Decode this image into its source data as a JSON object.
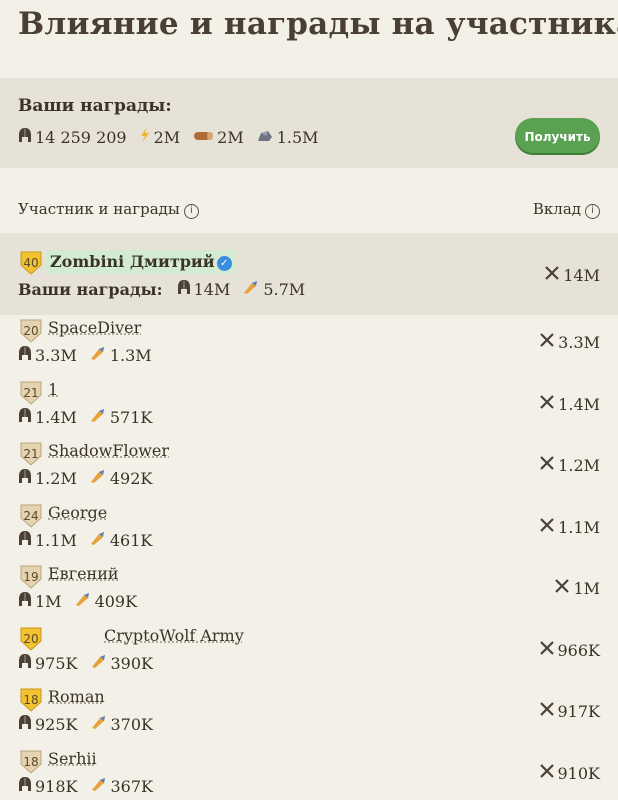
{
  "page_title": "Влияние и награды на участника",
  "your_rewards": {
    "title": "Ваши награды:",
    "items": [
      {
        "icon": "helmet-icon",
        "value": "14 259 209"
      },
      {
        "icon": "gold-icon",
        "value": "2M"
      },
      {
        "icon": "wood-icon",
        "value": "2M"
      },
      {
        "icon": "stone-icon",
        "value": "1.5M"
      }
    ],
    "claim_label": "Получить"
  },
  "table_header": {
    "participant_label": "Участник и награды",
    "contribution_label": "Вклад"
  },
  "me": {
    "level": "40",
    "name": "Zombini Дмитрий",
    "rewards_label": "Ваши награды:",
    "helmet": "14M",
    "food": "5.7M",
    "contribution": "14M"
  },
  "rows": [
    {
      "level": "20",
      "name": "SpaceDiver",
      "helmet": "3.3M",
      "food": "1.3M",
      "contribution": "3.3M"
    },
    {
      "level": "21",
      "name": "1",
      "helmet": "1.4M",
      "food": "571K",
      "contribution": "1.4M"
    },
    {
      "level": "21",
      "name": "ShadowFlower",
      "helmet": "1.2M",
      "food": "492K",
      "contribution": "1.2M"
    },
    {
      "level": "24",
      "name": "George",
      "helmet": "1.1M",
      "food": "461K",
      "contribution": "1.1M"
    },
    {
      "level": "19",
      "name": "Евгений",
      "helmet": "1M",
      "food": "409K",
      "contribution": "1M"
    },
    {
      "level": "20",
      "name": "CryptoWolf Army",
      "helmet": "975K",
      "food": "390K",
      "contribution": "966K"
    },
    {
      "level": "18",
      "name": "Roman",
      "helmet": "925K",
      "food": "370K",
      "contribution": "917K"
    },
    {
      "level": "18",
      "name": "Serhii",
      "helmet": "918K",
      "food": "367K",
      "contribution": "910K"
    }
  ],
  "colors": {
    "background": "#f3f0e8",
    "panel": "#e6e2d8",
    "accent_green": "#5aa152",
    "highlight_name": "#d3ecd1",
    "badge_gold": "#f2c230",
    "badge_beige": "#e3d3b0"
  }
}
